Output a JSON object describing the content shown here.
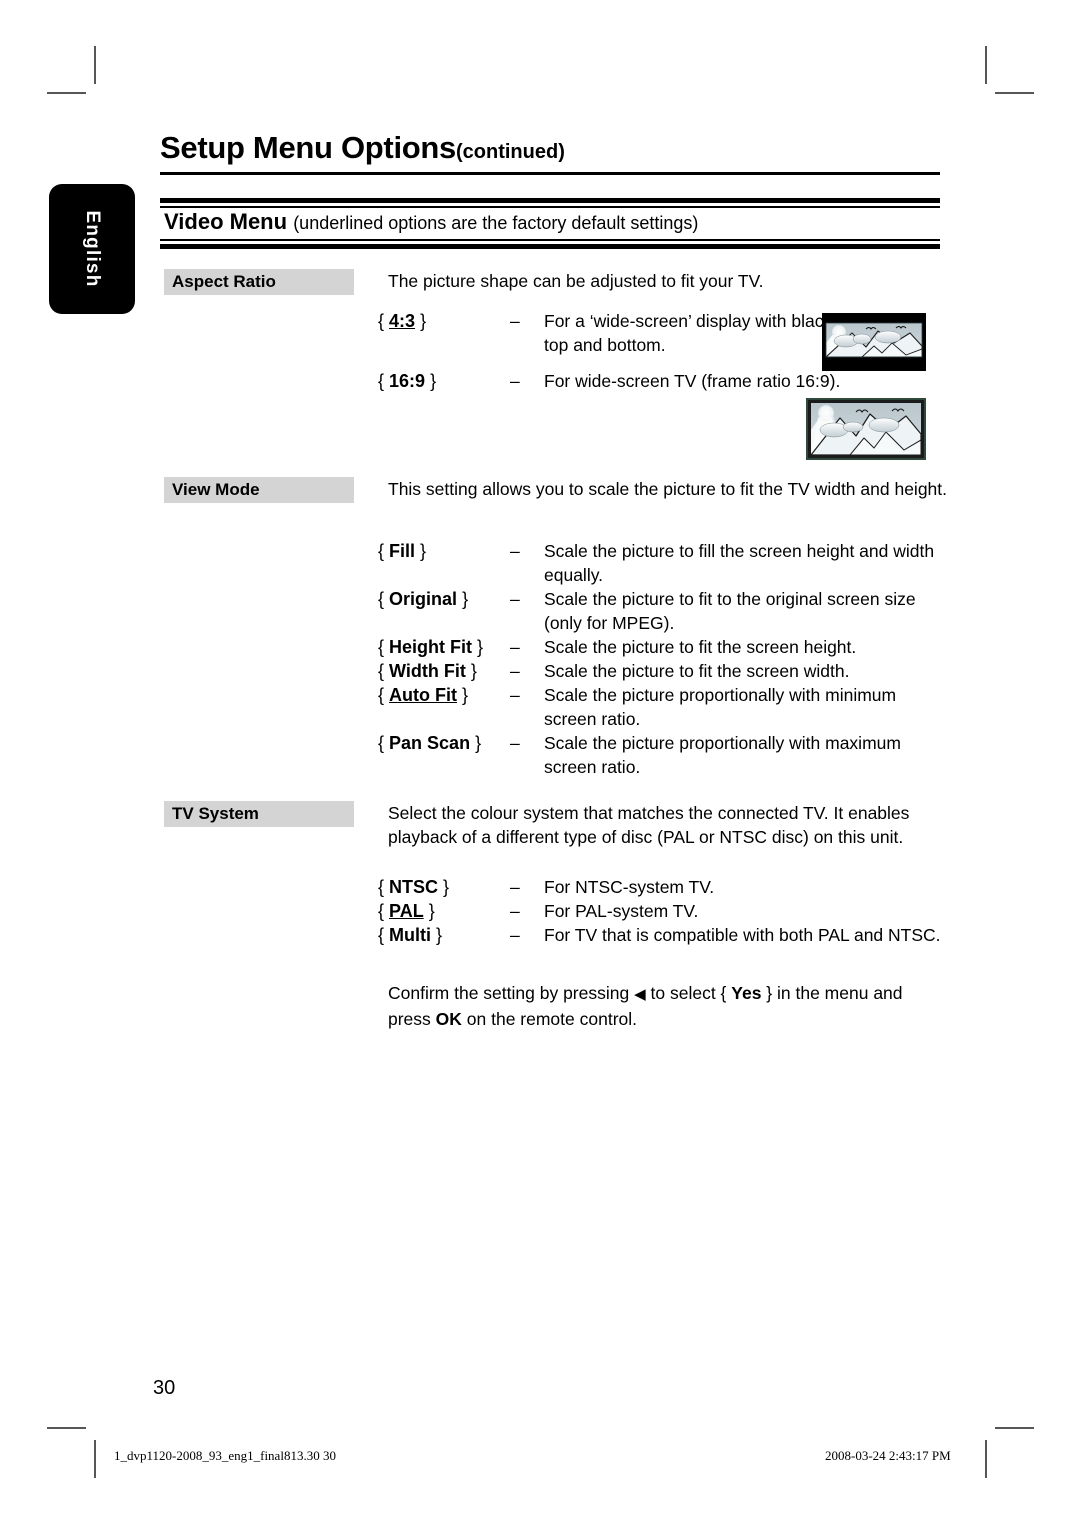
{
  "language_tab": {
    "label": "English"
  },
  "header": {
    "title": "Setup Menu Options",
    "title_continued": "(continued)",
    "section_title": "Video Menu",
    "section_note": "(underlined options are the factory default settings)"
  },
  "sections": [
    {
      "label": "Aspect Ratio",
      "intro": "The picture shape can be adjusted to fit your TV.",
      "options": [
        {
          "token_open": "{",
          "token": "4:3",
          "token_close": "}",
          "underlined": true,
          "dash": "–",
          "description": "For a ‘wide-screen’ display with black bars on the top and bottom.",
          "thumbnail": "tv-4-3-letterbox-image"
        },
        {
          "token_open": "{",
          "token": "16:9",
          "token_close": "}",
          "underlined": false,
          "dash": "–",
          "description": "For wide-screen TV (frame ratio 16:9).",
          "thumbnail": "tv-16-9-widescreen-image"
        }
      ]
    },
    {
      "label": "View Mode",
      "intro": "This setting allows you to scale the picture to fit the TV width and height.",
      "options": [
        {
          "token_open": "{",
          "token": "Fill",
          "token_close": "}",
          "underlined": false,
          "dash": "–",
          "description": "Scale the picture to fill the screen height and width equally."
        },
        {
          "token_open": "{",
          "token": "Original",
          "token_close": "}",
          "underlined": false,
          "dash": "–",
          "description": "Scale the picture to fit to the original screen size (only for MPEG)."
        },
        {
          "token_open": "{",
          "token": "Height Fit",
          "token_close": "}",
          "underlined": false,
          "dash": "–",
          "description": "Scale the picture to fit the screen height."
        },
        {
          "token_open": "{",
          "token": "Width Fit",
          "token_close": "}",
          "underlined": false,
          "dash": "–",
          "description": "Scale the picture to fit the screen width."
        },
        {
          "token_open": "{",
          "token": "Auto Fit",
          "token_close": "}",
          "underlined": true,
          "dash": "–",
          "description": "Scale the picture proportionally with minimum screen ratio."
        },
        {
          "token_open": "{",
          "token": "Pan Scan",
          "token_close": "}",
          "underlined": false,
          "dash": "–",
          "description": "Scale the picture proportionally with maximum screen ratio."
        }
      ]
    },
    {
      "label": "TV System",
      "intro": "Select the colour system that matches the connected TV. It enables playback of a different type of disc (PAL or NTSC disc) on this unit.",
      "options": [
        {
          "token_open": "{",
          "token": "NTSC",
          "token_close": "}",
          "underlined": false,
          "dash": "–",
          "description": "For NTSC-system TV."
        },
        {
          "token_open": "{",
          "token": "PAL",
          "token_close": "}",
          "underlined": true,
          "dash": "–",
          "description": "For PAL-system TV."
        },
        {
          "token_open": "{",
          "token": "Multi",
          "token_close": "}",
          "underlined": false,
          "dash": "–",
          "description": "For TV that is compatible with both PAL and NTSC."
        }
      ],
      "confirm": {
        "part1": "Confirm the setting by pressing ",
        "arrow": "◀",
        "part2": " to select { ",
        "yes": "Yes",
        "part3": " } in the menu and press ",
        "ok": "OK",
        "part4": " on the remote control."
      }
    }
  ],
  "footer": {
    "page_number": "30",
    "file_reference": "1_dvp1120-2008_93_eng1_final813.30   30",
    "timestamp": "2008-03-24   2:43:17 PM"
  },
  "colors": {
    "chip_background": "#d4d4d4",
    "rule": "#000000",
    "tab_background": "#000000",
    "crop_mark": "#555759"
  }
}
